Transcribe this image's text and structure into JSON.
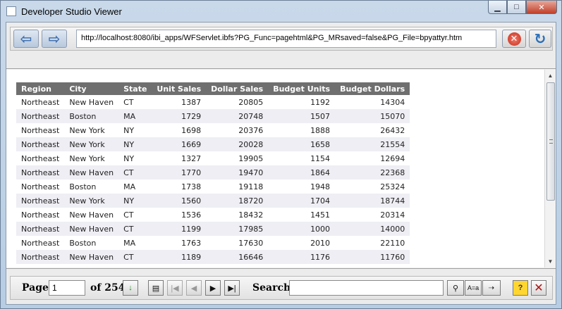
{
  "window": {
    "title": "Developer Studio Viewer",
    "controls": {
      "minimize": "▁",
      "maximize": "□",
      "close": "✕"
    }
  },
  "toolbar": {
    "back_icon": "⇦",
    "forward_icon": "⇨",
    "url": "http://localhost:8080/ibi_apps/WFServlet.ibfs?PG_Func=pagehtml&PG_MRsaved=false&PG_File=bpyattyr.htm",
    "stop_icon": "✕",
    "refresh_icon": "↻"
  },
  "report": {
    "columns": [
      "Region",
      "City",
      "State",
      "Unit Sales",
      "Dollar Sales",
      "Budget Units",
      "Budget Dollars"
    ],
    "rows": [
      [
        "Northeast",
        "New Haven",
        "CT",
        "1387",
        "20805",
        "1192",
        "14304"
      ],
      [
        "Northeast",
        "Boston",
        "MA",
        "1729",
        "20748",
        "1507",
        "15070"
      ],
      [
        "Northeast",
        "New York",
        "NY",
        "1698",
        "20376",
        "1888",
        "26432"
      ],
      [
        "Northeast",
        "New York",
        "NY",
        "1669",
        "20028",
        "1658",
        "21554"
      ],
      [
        "Northeast",
        "New York",
        "NY",
        "1327",
        "19905",
        "1154",
        "12694"
      ],
      [
        "Northeast",
        "New Haven",
        "CT",
        "1770",
        "19470",
        "1864",
        "22368"
      ],
      [
        "Northeast",
        "Boston",
        "MA",
        "1738",
        "19118",
        "1948",
        "25324"
      ],
      [
        "Northeast",
        "New York",
        "NY",
        "1560",
        "18720",
        "1704",
        "18744"
      ],
      [
        "Northeast",
        "New Haven",
        "CT",
        "1536",
        "18432",
        "1451",
        "20314"
      ],
      [
        "Northeast",
        "New Haven",
        "CT",
        "1199",
        "17985",
        "1000",
        "14000"
      ],
      [
        "Northeast",
        "Boston",
        "MA",
        "1763",
        "17630",
        "2010",
        "22110"
      ],
      [
        "Northeast",
        "New Haven",
        "CT",
        "1189",
        "16646",
        "1176",
        "11760"
      ]
    ]
  },
  "scrollbar": {
    "up_arrow": "▲",
    "down_arrow": "▼"
  },
  "pager": {
    "page_label": "Page",
    "page_value": "1",
    "of_label": "of 254",
    "go_icon": "↓",
    "first_icon": "|◀",
    "prev_icon": "◀",
    "next_icon": "▶",
    "last_icon": "▶|",
    "search_label": "Search",
    "search_value": "",
    "find_icon": "⚲",
    "case_icon": "A=a",
    "next_match_icon": "⇢",
    "help_icon": "?",
    "close_icon": "✕"
  }
}
